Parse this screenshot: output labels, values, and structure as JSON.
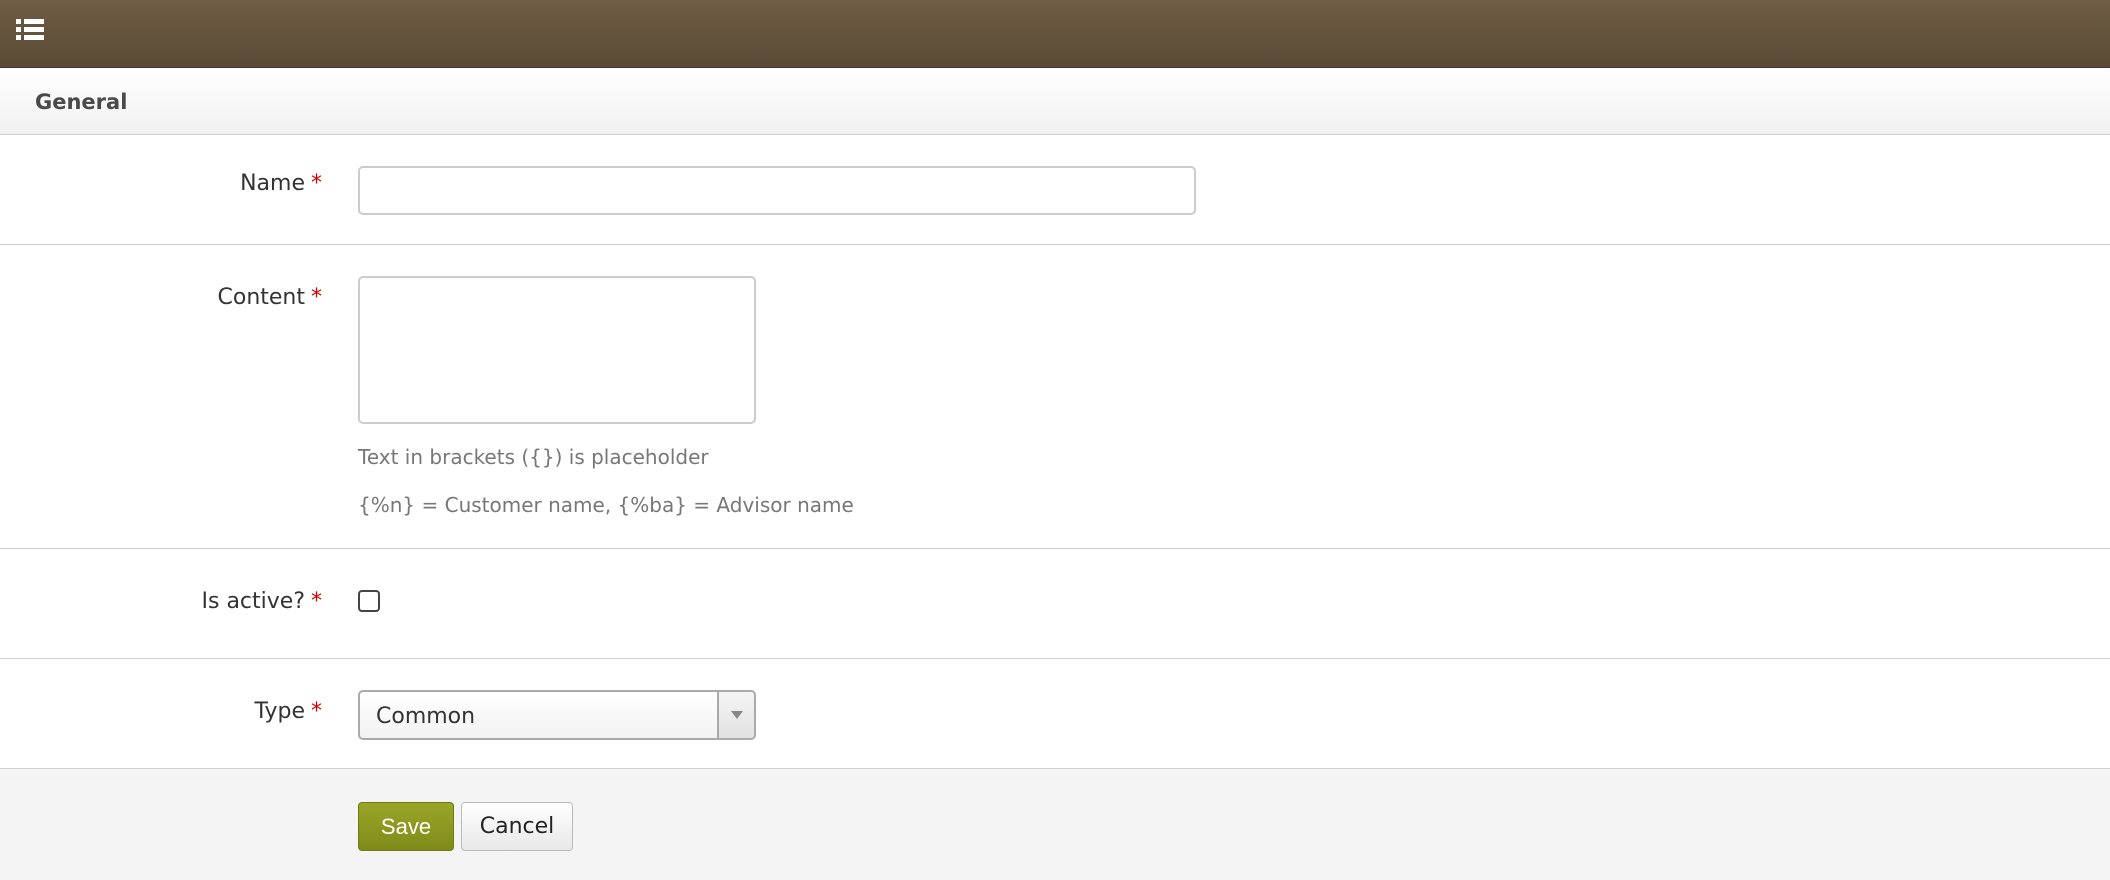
{
  "header": {
    "menu_icon": "list-icon",
    "background_color": "#5f4f39"
  },
  "section": {
    "title": "General"
  },
  "form": {
    "required_marker": "*",
    "name": {
      "label": "Name",
      "value": ""
    },
    "content": {
      "label": "Content",
      "value": "",
      "help_line1": "Text in brackets ({}) is placeholder",
      "help_line2": "{%n} = Customer name, {%ba} = Advisor name"
    },
    "is_active": {
      "label": "Is active?",
      "checked": false
    },
    "type": {
      "label": "Type",
      "selected": "Common"
    }
  },
  "actions": {
    "save_label": "Save",
    "cancel_label": "Cancel",
    "save_color": "#8c9720"
  }
}
